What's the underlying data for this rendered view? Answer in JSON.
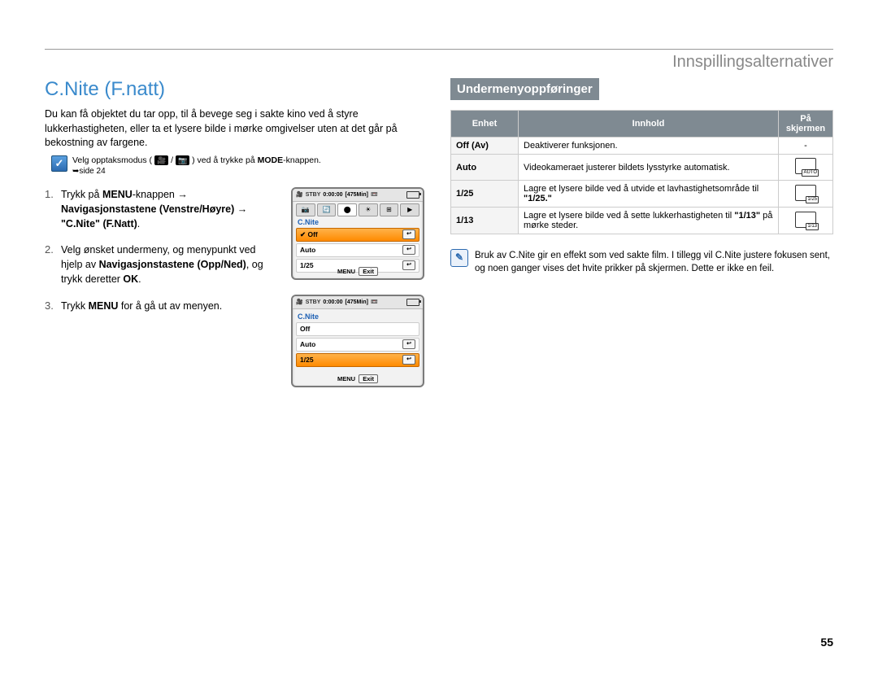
{
  "header": {
    "title": "Innspillingsalternativer"
  },
  "section_title": "C.Nite (F.natt)",
  "intro": "Du kan få objektet du tar opp, til å bevege seg i sakte kino ved å styre lukkerhastigheten, eller ta et lysere bilde i mørke omgivelser uten at det går på bekostning av fargene.",
  "mode_note": {
    "icon": "✓",
    "prefix": "Velg opptaksmodus ( ",
    "video_glyph": "🎥",
    "sep": " / ",
    "photo_glyph": "📷",
    "suffix": " ) ved å trykke på ",
    "mode_bold": "MODE",
    "suffix2": "-knappen.",
    "pagelink": "➥side 24"
  },
  "steps": [
    {
      "plain1": "Trykk på ",
      "bold1": "MENU",
      "plain2": "-knappen ",
      "arrow1": "→",
      "bold2": " Navigasjonstastene (Venstre/Høyre) ",
      "arrow2": "→",
      "bold3": " \"C.Nite\" (F.Natt)",
      "plain3": "."
    },
    {
      "plain1": "Velg ønsket undermeny, og menypunkt ved hjelp av ",
      "bold1": "Navigasjonstastene (Opp/Ned)",
      "plain2": ", og trykk deretter ",
      "bold2": "OK",
      "plain3": "."
    },
    {
      "plain1": "Trykk ",
      "bold1": "MENU",
      "plain2": " for å gå ut av menyen."
    }
  ],
  "lcd": {
    "stby": "STBY",
    "time": "0:00:00",
    "remain": "[475Min]",
    "title": "C.Nite",
    "items1": [
      "Off",
      "Auto",
      "1/25"
    ],
    "items2": [
      "Off",
      "Auto",
      "1/25"
    ],
    "selected1": 0,
    "menu": "MENU",
    "exit": "Exit"
  },
  "right": {
    "submenu_header": "Undermenyoppføringer",
    "table": {
      "headers": [
        "Enhet",
        "Innhold",
        "På skjermen"
      ],
      "rows": [
        {
          "unit": "Off (Av)",
          "content": "Deaktiverer funksjonen.",
          "icon": "-",
          "icon_label": ""
        },
        {
          "unit": "Auto",
          "content": "Videokameraet justerer bildets lysstyrke automatisk.",
          "icon": "screen",
          "icon_label": "AUTO"
        },
        {
          "unit": "1/25",
          "content_a": "Lagre et lysere bilde ved å utvide et lavhastighetsområde til ",
          "content_b": "\"1/25.\"",
          "icon": "screen",
          "icon_label": "1/25"
        },
        {
          "unit": "1/13",
          "content_a": "Lagre et lysere bilde ved å sette lukkerhastigheten til ",
          "content_b": "\"1/13\"",
          "content_c": " på mørke steder.",
          "icon": "screen",
          "icon_label": "1/13"
        }
      ]
    },
    "note_icon": "✎",
    "note_text": "Bruk av C.Nite gir en effekt som ved sakte film. I tillegg vil C.Nite justere fokusen sent, og noen ganger vises det hvite prikker på skjermen. Dette er ikke en feil."
  },
  "page_number": "55"
}
